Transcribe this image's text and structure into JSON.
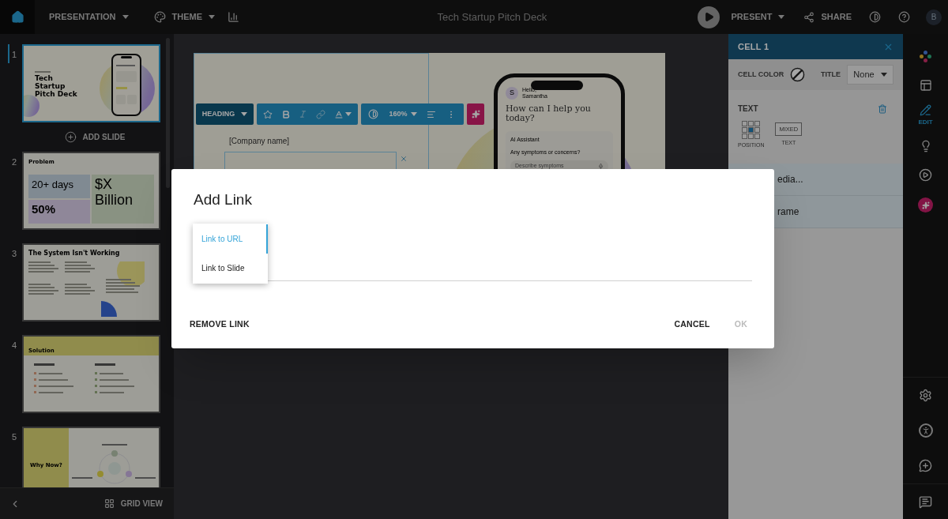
{
  "top_bar": {
    "menus": [
      {
        "label": "PRESENTATION"
      },
      {
        "label": "THEME"
      }
    ],
    "title": "Tech Startup Pitch Deck",
    "present": "PRESENT",
    "share": "SHARE",
    "avatar": "B"
  },
  "slides_panel": {
    "add_slide": "ADD SLIDE",
    "grid_view": "GRID VIEW",
    "slides": [
      {
        "number": "1",
        "selected": true,
        "kind": "title",
        "title_lines": [
          "Tech",
          "Startup",
          "Pitch Deck"
        ]
      },
      {
        "number": "2",
        "selected": false,
        "kind": "problem",
        "title": "Problem",
        "stats": [
          "20+ days",
          "50%",
          "$X Billion"
        ]
      },
      {
        "number": "3",
        "selected": false,
        "kind": "quotes",
        "title": "The System Isn't Working"
      },
      {
        "number": "4",
        "selected": false,
        "kind": "solution",
        "title": "Solution"
      },
      {
        "number": "5",
        "selected": false,
        "kind": "why_now",
        "title": "Why Now?"
      }
    ]
  },
  "editor": {
    "toolbar": {
      "style": "HEADING",
      "zoom": "160%"
    },
    "slide": {
      "company": "[Company name]",
      "phone": {
        "avatar": "S",
        "greeting": "Hello, Samantha",
        "question": "How can I help you today?",
        "assistant": "AI Assistant",
        "prompt": "Any symptoms or concerns?",
        "placeholder": "Describe symptoms"
      }
    }
  },
  "cell_panel": {
    "title": "CELL 1",
    "cell_color_label": "CELL COLOR",
    "title_label": "TITLE",
    "title_value": "None",
    "text_section": "TEXT",
    "position_label": "POSITION",
    "text_mode": "MIXED",
    "text_mode_label": "TEXT",
    "position_cells": [
      {
        "selected": false
      },
      {
        "selected": false
      },
      {
        "selected": false
      },
      {
        "selected": false
      },
      {
        "selected": true
      },
      {
        "selected": false
      },
      {
        "selected": false
      },
      {
        "selected": false
      },
      {
        "selected": false
      }
    ],
    "items": [
      "edia...",
      "rame"
    ]
  },
  "rail": {
    "tools": [
      {
        "kind": "palette",
        "selected": false
      },
      {
        "kind": "layout",
        "selected": false
      },
      {
        "kind": "edit",
        "label": "EDIT",
        "selected": true
      },
      {
        "kind": "idea",
        "selected": false
      },
      {
        "kind": "play",
        "selected": false
      },
      {
        "kind": "ai",
        "selected": false
      }
    ],
    "bottom_tools": [
      {
        "kind": "settings"
      },
      {
        "kind": "accessibility"
      },
      {
        "kind": "chat"
      },
      {
        "kind": "comments"
      }
    ]
  },
  "dialog": {
    "title": "Add Link",
    "menu": [
      {
        "label": "Link to URL",
        "selected": true
      },
      {
        "label": "Link to Slide",
        "selected": false
      }
    ],
    "remove": "REMOVE LINK",
    "cancel": "CANCEL",
    "ok": {
      "label": "OK",
      "disabled": true
    }
  }
}
